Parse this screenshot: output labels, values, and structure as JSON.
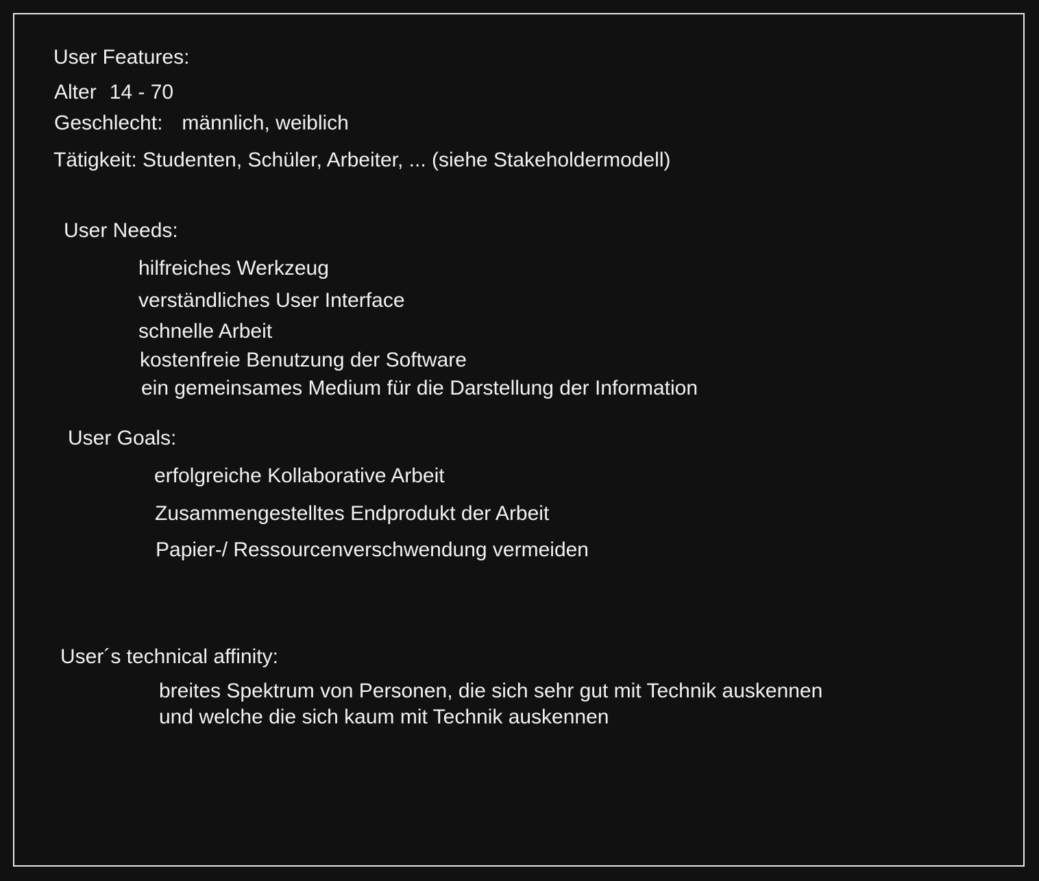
{
  "features": {
    "heading": "User Features:",
    "age_label": "Alter",
    "age_value": "14 - 70",
    "gender_label": "Geschlecht:",
    "gender_value": "männlich, weiblich",
    "occupation": "Tätigkeit: Studenten, Schüler, Arbeiter, ... (siehe Stakeholdermodell)"
  },
  "needs": {
    "heading": "User Needs:",
    "items": [
      "hilfreiches Werkzeug",
      "verständliches User Interface",
      "schnelle Arbeit",
      "kostenfreie Benutzung der Software",
      "ein gemeinsames Medium für die Darstellung der Information"
    ]
  },
  "goals": {
    "heading": "User Goals:",
    "items": [
      "erfolgreiche Kollaborative Arbeit",
      "Zusammengestelltes Endprodukt der Arbeit",
      "Papier-/ Ressourcenverschwendung vermeiden"
    ]
  },
  "affinity": {
    "heading": "User´s technical affinity:",
    "lines": [
      "breites Spektrum von Personen, die sich sehr gut mit Technik auskennen",
      "und welche die sich kaum mit Technik auskennen"
    ]
  },
  "colors": {
    "background": "#111111",
    "border": "#e8e8e8",
    "text": "#f2f2f2"
  }
}
